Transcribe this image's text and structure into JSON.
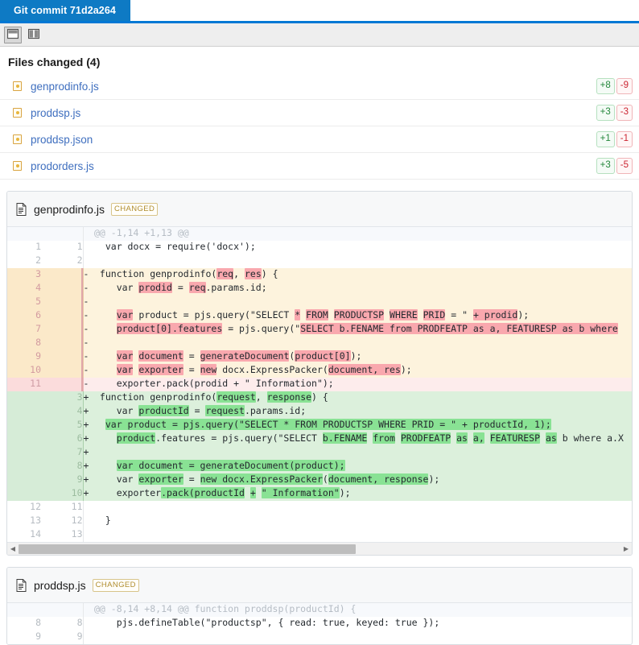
{
  "window": {
    "tab_label": "Git commit 71d2a264"
  },
  "toolbar": {
    "buttons": [
      {
        "name": "unified-view-button",
        "icon": "unified-view-icon",
        "active": true
      },
      {
        "name": "split-view-button",
        "icon": "split-view-icon",
        "active": false
      }
    ]
  },
  "files_changed": {
    "title": "Files changed (4)",
    "items": [
      {
        "name": "genprodinfo.js",
        "additions": "+8",
        "deletions": "-9"
      },
      {
        "name": "proddsp.js",
        "additions": "+3",
        "deletions": "-3"
      },
      {
        "name": "proddsp.json",
        "additions": "+1",
        "deletions": "-1"
      },
      {
        "name": "prodorders.js",
        "additions": "+3",
        "deletions": "-5"
      }
    ]
  },
  "diffs": [
    {
      "filename": "genprodinfo.js",
      "status": "CHANGED",
      "hunk_header": "@@ -1,14 +1,13 @@",
      "hunk_context": "",
      "rows": [
        {
          "type": "hunk",
          "old": "",
          "new": "",
          "sign": "",
          "code": "@@ -1,14 +1,13 @@"
        },
        {
          "type": "ctx",
          "old": "1",
          "new": "1",
          "sign": "",
          "code": "  var docx = require('docx');"
        },
        {
          "type": "ctx",
          "old": "2",
          "new": "2",
          "sign": "",
          "code": ""
        },
        {
          "type": "del",
          "old": "3",
          "new": "",
          "sign": "-",
          "code": " function genprodinfo(req, res) {"
        },
        {
          "type": "del",
          "old": "4",
          "new": "",
          "sign": "-",
          "code": "    var prodid = req.params.id;"
        },
        {
          "type": "del",
          "old": "5",
          "new": "",
          "sign": "-",
          "code": ""
        },
        {
          "type": "del",
          "old": "6",
          "new": "",
          "sign": "-",
          "code": "    var product = pjs.query(\"SELECT * FROM PRODUCTSP WHERE PRID = \" + prodid);"
        },
        {
          "type": "del",
          "old": "7",
          "new": "",
          "sign": "-",
          "code": "    product[0].features = pjs.query(\"SELECT b.FENAME from PRODFEATP as a, FEATURESP as b where"
        },
        {
          "type": "del",
          "old": "8",
          "new": "",
          "sign": "-",
          "code": ""
        },
        {
          "type": "del",
          "old": "9",
          "new": "",
          "sign": "-",
          "code": "    var document = generateDocument(product[0]);"
        },
        {
          "type": "del",
          "old": "10",
          "new": "",
          "sign": "-",
          "code": "    var exporter = new docx.ExpressPacker(document, res);"
        },
        {
          "type": "del_strong",
          "old": "11",
          "new": "",
          "sign": "-",
          "code": "    exporter.pack(prodid + \" Information\");"
        },
        {
          "type": "add",
          "old": "",
          "new": "3",
          "sign": "+",
          "code": " function genprodinfo(request, response) {"
        },
        {
          "type": "add",
          "old": "",
          "new": "4",
          "sign": "+",
          "code": "    var productId = request.params.id;"
        },
        {
          "type": "add",
          "old": "",
          "new": "5",
          "sign": "+",
          "code": "  var product = pjs.query(\"SELECT * FROM PRODUCTSP WHERE PRID = \" + productId, 1);"
        },
        {
          "type": "add",
          "old": "",
          "new": "6",
          "sign": "+",
          "code": "    product.features = pjs.query(\"SELECT b.FENAME from PRODFEATP as a, FEATURESP as b where a.X"
        },
        {
          "type": "add",
          "old": "",
          "new": "7",
          "sign": "+",
          "code": ""
        },
        {
          "type": "add",
          "old": "",
          "new": "8",
          "sign": "+",
          "code": "    var document = generateDocument(product);"
        },
        {
          "type": "add",
          "old": "",
          "new": "9",
          "sign": "+",
          "code": "    var exporter = new docx.ExpressPacker(document, response);"
        },
        {
          "type": "add",
          "old": "",
          "new": "10",
          "sign": "+",
          "code": "    exporter.pack(productId + \" Information\");"
        },
        {
          "type": "ctx",
          "old": "12",
          "new": "11",
          "sign": "",
          "code": ""
        },
        {
          "type": "ctx",
          "old": "13",
          "new": "12",
          "sign": "",
          "code": "  }"
        },
        {
          "type": "ctx",
          "old": "14",
          "new": "13",
          "sign": "",
          "code": ""
        }
      ]
    },
    {
      "filename": "proddsp.js",
      "status": "CHANGED",
      "hunk_header": "@@ -8,14 +8,14 @@",
      "hunk_context": "function proddsp(productId) {",
      "rows": [
        {
          "type": "hunk",
          "old": "",
          "new": "",
          "sign": "",
          "code": "@@ -8,14 +8,14 @@ function proddsp(productId) {"
        },
        {
          "type": "ctx",
          "old": "8",
          "new": "8",
          "sign": "",
          "code": "    pjs.defineTable(\"productsp\", { read: true, keyed: true });"
        },
        {
          "type": "ctx",
          "old": "9",
          "new": "9",
          "sign": "",
          "code": ""
        }
      ]
    }
  ],
  "scrollbar": {
    "left_arrow": "◀",
    "right_arrow": "▶"
  }
}
